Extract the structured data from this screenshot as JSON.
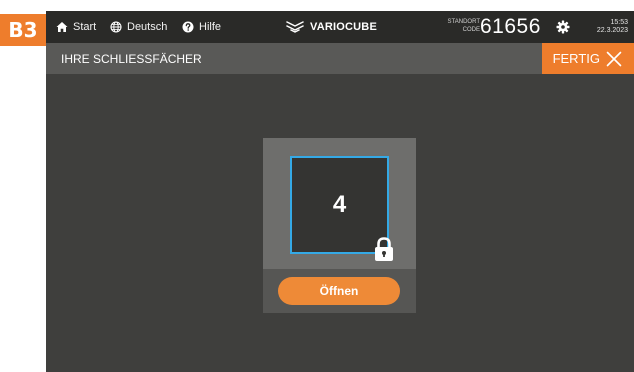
{
  "step_badge": "B3",
  "nav": {
    "start_label": "Start",
    "language_label": "Deutsch",
    "help_label": "Hilfe"
  },
  "brand": "VARIOCUBE",
  "location": {
    "label_line1": "STANDORT",
    "label_line2": "CODE",
    "code": "61656"
  },
  "clock": {
    "time": "15:53",
    "date": "22.3.2023"
  },
  "header": {
    "title": "IHRE SCHLIESSFÄCHER",
    "done_label": "FERTIG"
  },
  "locker": {
    "number": "4",
    "status": "locked",
    "open_label": "Öffnen"
  },
  "colors": {
    "accent_orange": "#ee7d2c",
    "selection_blue": "#34a9e6",
    "background": "#3f3f3d",
    "topbar": "#2a2a28"
  },
  "icons": {
    "start": "home-icon",
    "language": "globe-icon",
    "help": "help-icon",
    "settings": "gear-icon",
    "done": "close-icon",
    "locker_status": "lock-icon"
  }
}
